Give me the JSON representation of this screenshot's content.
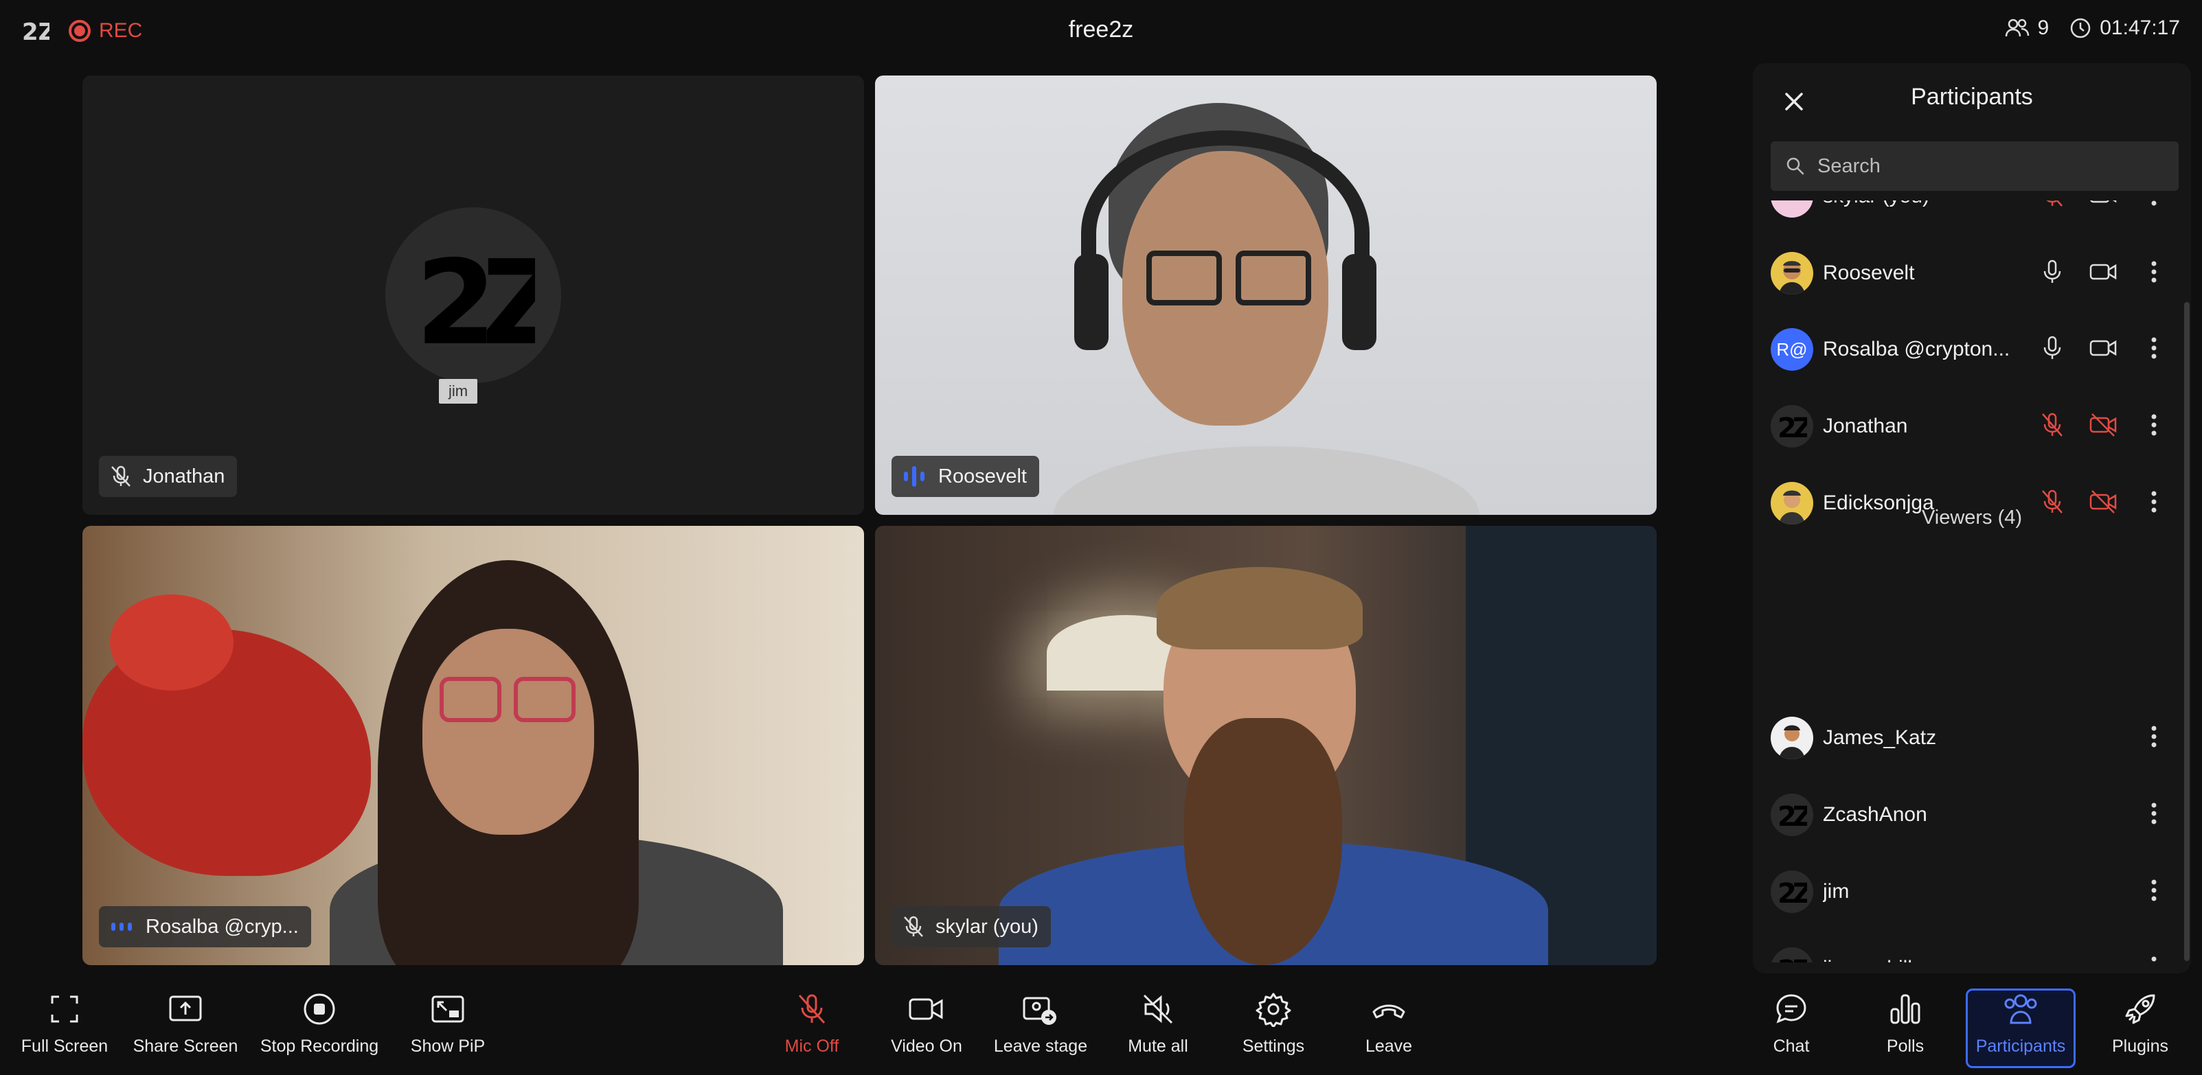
{
  "topbar": {
    "rec_label": "REC",
    "meeting_title": "free2z",
    "participant_count": "9",
    "elapsed_time": "01:47:17"
  },
  "tiles": [
    {
      "name": "Jonathan",
      "avatar_tag": "jim",
      "mic": "muted"
    },
    {
      "name": "Roosevelt",
      "mic": "speaking"
    },
    {
      "name": "Rosalba @cryp...",
      "mic": "speaking"
    },
    {
      "name": "skylar (you)",
      "mic": "muted"
    }
  ],
  "panel": {
    "title": "Participants",
    "search_placeholder": "Search",
    "participants": [
      {
        "name": "skylar (you)",
        "mic": "off",
        "video": "on"
      },
      {
        "name": "Roosevelt",
        "mic": "on",
        "video": "on"
      },
      {
        "name": "Rosalba @crypton...",
        "initials": "R@",
        "mic": "on",
        "video": "on"
      },
      {
        "name": "Jonathan",
        "mic": "off",
        "video": "off"
      },
      {
        "name": "Edicksonjga",
        "mic": "off",
        "video": "off"
      }
    ],
    "viewers_title": "Viewers (4)",
    "viewers": [
      {
        "name": "James_Katz"
      },
      {
        "name": "ZcashAnon"
      },
      {
        "name": "jim"
      },
      {
        "name": "jimmyshill"
      }
    ]
  },
  "toolbar": {
    "full_screen": "Full Screen",
    "share_screen": "Share Screen",
    "stop_recording": "Stop Recording",
    "show_pip": "Show PiP",
    "mic_off": "Mic Off",
    "video_on": "Video On",
    "leave_stage": "Leave stage",
    "mute_all": "Mute all",
    "settings": "Settings",
    "leave": "Leave",
    "chat": "Chat",
    "polls": "Polls",
    "participants": "Participants",
    "plugins": "Plugins"
  },
  "colors": {
    "accent": "#3d6bff",
    "danger": "#e24a43",
    "background": "#0f0f0f",
    "panel": "#161616"
  }
}
